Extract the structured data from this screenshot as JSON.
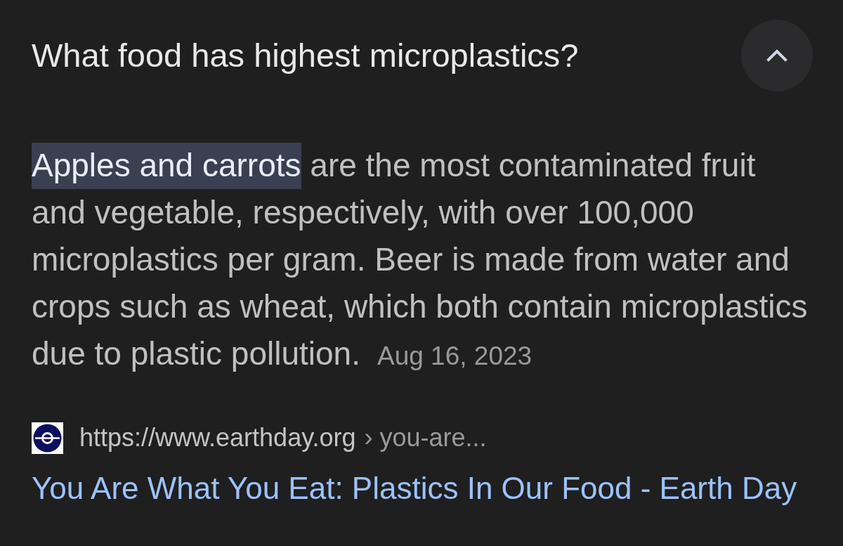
{
  "question": {
    "text": "What food has highest microplastics?",
    "expanded": true
  },
  "answer": {
    "segments": [
      {
        "text": "Apples and carrots",
        "highlighted": true
      },
      {
        "text": " are the most contaminated fruit and vegetable, respectively, with over 100,000 microplastics per gram. Beer is made from water and crops such as wheat, which both contain microplastics due to plastic pollution.",
        "highlighted": false
      }
    ],
    "date": "Aug 16, 2023"
  },
  "source": {
    "url": "https://www.earthday.org",
    "separator": "›",
    "path": "you-are...",
    "title": "You Are What You Eat: Plastics In Our Food - Earth Day"
  }
}
